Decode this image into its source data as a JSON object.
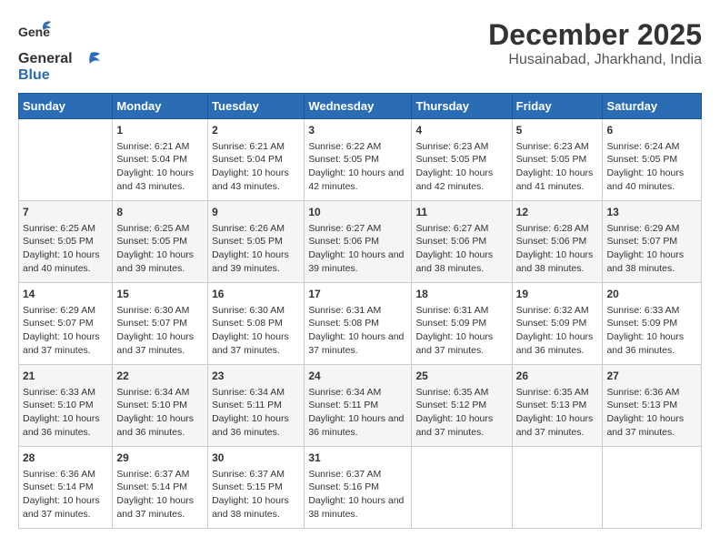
{
  "header": {
    "logo_general": "General",
    "logo_blue": "Blue",
    "title": "December 2025",
    "subtitle": "Husainabad, Jharkhand, India"
  },
  "weekdays": [
    "Sunday",
    "Monday",
    "Tuesday",
    "Wednesday",
    "Thursday",
    "Friday",
    "Saturday"
  ],
  "weeks": [
    [
      {
        "day": "",
        "info": ""
      },
      {
        "day": "1",
        "sunrise": "6:21 AM",
        "sunset": "5:04 PM",
        "daylight": "10 hours and 43 minutes."
      },
      {
        "day": "2",
        "sunrise": "6:21 AM",
        "sunset": "5:04 PM",
        "daylight": "10 hours and 43 minutes."
      },
      {
        "day": "3",
        "sunrise": "6:22 AM",
        "sunset": "5:05 PM",
        "daylight": "10 hours and 42 minutes."
      },
      {
        "day": "4",
        "sunrise": "6:23 AM",
        "sunset": "5:05 PM",
        "daylight": "10 hours and 42 minutes."
      },
      {
        "day": "5",
        "sunrise": "6:23 AM",
        "sunset": "5:05 PM",
        "daylight": "10 hours and 41 minutes."
      },
      {
        "day": "6",
        "sunrise": "6:24 AM",
        "sunset": "5:05 PM",
        "daylight": "10 hours and 40 minutes."
      }
    ],
    [
      {
        "day": "7",
        "sunrise": "6:25 AM",
        "sunset": "5:05 PM",
        "daylight": "10 hours and 40 minutes."
      },
      {
        "day": "8",
        "sunrise": "6:25 AM",
        "sunset": "5:05 PM",
        "daylight": "10 hours and 39 minutes."
      },
      {
        "day": "9",
        "sunrise": "6:26 AM",
        "sunset": "5:05 PM",
        "daylight": "10 hours and 39 minutes."
      },
      {
        "day": "10",
        "sunrise": "6:27 AM",
        "sunset": "5:06 PM",
        "daylight": "10 hours and 39 minutes."
      },
      {
        "day": "11",
        "sunrise": "6:27 AM",
        "sunset": "5:06 PM",
        "daylight": "10 hours and 38 minutes."
      },
      {
        "day": "12",
        "sunrise": "6:28 AM",
        "sunset": "5:06 PM",
        "daylight": "10 hours and 38 minutes."
      },
      {
        "day": "13",
        "sunrise": "6:29 AM",
        "sunset": "5:07 PM",
        "daylight": "10 hours and 38 minutes."
      }
    ],
    [
      {
        "day": "14",
        "sunrise": "6:29 AM",
        "sunset": "5:07 PM",
        "daylight": "10 hours and 37 minutes."
      },
      {
        "day": "15",
        "sunrise": "6:30 AM",
        "sunset": "5:07 PM",
        "daylight": "10 hours and 37 minutes."
      },
      {
        "day": "16",
        "sunrise": "6:30 AM",
        "sunset": "5:08 PM",
        "daylight": "10 hours and 37 minutes."
      },
      {
        "day": "17",
        "sunrise": "6:31 AM",
        "sunset": "5:08 PM",
        "daylight": "10 hours and 37 minutes."
      },
      {
        "day": "18",
        "sunrise": "6:31 AM",
        "sunset": "5:09 PM",
        "daylight": "10 hours and 37 minutes."
      },
      {
        "day": "19",
        "sunrise": "6:32 AM",
        "sunset": "5:09 PM",
        "daylight": "10 hours and 36 minutes."
      },
      {
        "day": "20",
        "sunrise": "6:33 AM",
        "sunset": "5:09 PM",
        "daylight": "10 hours and 36 minutes."
      }
    ],
    [
      {
        "day": "21",
        "sunrise": "6:33 AM",
        "sunset": "5:10 PM",
        "daylight": "10 hours and 36 minutes."
      },
      {
        "day": "22",
        "sunrise": "6:34 AM",
        "sunset": "5:10 PM",
        "daylight": "10 hours and 36 minutes."
      },
      {
        "day": "23",
        "sunrise": "6:34 AM",
        "sunset": "5:11 PM",
        "daylight": "10 hours and 36 minutes."
      },
      {
        "day": "24",
        "sunrise": "6:34 AM",
        "sunset": "5:11 PM",
        "daylight": "10 hours and 36 minutes."
      },
      {
        "day": "25",
        "sunrise": "6:35 AM",
        "sunset": "5:12 PM",
        "daylight": "10 hours and 37 minutes."
      },
      {
        "day": "26",
        "sunrise": "6:35 AM",
        "sunset": "5:13 PM",
        "daylight": "10 hours and 37 minutes."
      },
      {
        "day": "27",
        "sunrise": "6:36 AM",
        "sunset": "5:13 PM",
        "daylight": "10 hours and 37 minutes."
      }
    ],
    [
      {
        "day": "28",
        "sunrise": "6:36 AM",
        "sunset": "5:14 PM",
        "daylight": "10 hours and 37 minutes."
      },
      {
        "day": "29",
        "sunrise": "6:37 AM",
        "sunset": "5:14 PM",
        "daylight": "10 hours and 37 minutes."
      },
      {
        "day": "30",
        "sunrise": "6:37 AM",
        "sunset": "5:15 PM",
        "daylight": "10 hours and 38 minutes."
      },
      {
        "day": "31",
        "sunrise": "6:37 AM",
        "sunset": "5:16 PM",
        "daylight": "10 hours and 38 minutes."
      },
      {
        "day": "",
        "info": ""
      },
      {
        "day": "",
        "info": ""
      },
      {
        "day": "",
        "info": ""
      }
    ]
  ]
}
